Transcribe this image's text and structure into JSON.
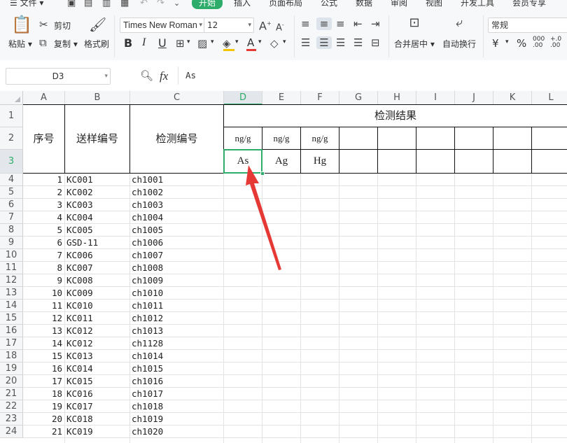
{
  "menu": {
    "items": [
      "文件",
      "开始",
      "插入",
      "页面布局",
      "公式",
      "数据",
      "审阅",
      "视图",
      "开发工具",
      "会员专享"
    ]
  },
  "ribbon": {
    "paste_label": "粘贴",
    "cut_label": "剪切",
    "copy_label": "复制",
    "format_painter_label": "格式刷",
    "font_name": "Times New Roman",
    "font_size": "12",
    "bold": "B",
    "italic": "I",
    "underline": "U",
    "font_color_glyph": "A",
    "merge_center_label": "合并居中",
    "wrap_text_label": "自动换行",
    "number_format": "常规",
    "currency": "¥",
    "percent": "%"
  },
  "formula_bar": {
    "cell_ref": "D3",
    "fx": "fx",
    "value": "As"
  },
  "columns": [
    "A",
    "B",
    "C",
    "D",
    "E",
    "F",
    "G",
    "H",
    "I",
    "J",
    "K",
    "L"
  ],
  "selected_column": "D",
  "selected_row": "3",
  "header_cells": {
    "seq": "序号",
    "sample_no": "送样编号",
    "test_no": "检测编号",
    "result": "检测结果",
    "units": [
      "ng/g",
      "ng/g",
      "ng/g"
    ],
    "elements": [
      "As",
      "Ag",
      "Hg"
    ]
  },
  "rows": [
    {
      "row": "4",
      "seq": "1",
      "sample": "KC001",
      "test": "ch1001"
    },
    {
      "row": "5",
      "seq": "2",
      "sample": "KC002",
      "test": "ch1002"
    },
    {
      "row": "6",
      "seq": "3",
      "sample": "KC003",
      "test": "ch1003"
    },
    {
      "row": "7",
      "seq": "4",
      "sample": "KC004",
      "test": "ch1004"
    },
    {
      "row": "8",
      "seq": "5",
      "sample": "KC005",
      "test": "ch1005"
    },
    {
      "row": "9",
      "seq": "6",
      "sample": "GSD-11",
      "test": "ch1006"
    },
    {
      "row": "10",
      "seq": "7",
      "sample": "KC006",
      "test": "ch1007"
    },
    {
      "row": "11",
      "seq": "8",
      "sample": "KC007",
      "test": "ch1008"
    },
    {
      "row": "12",
      "seq": "9",
      "sample": "KC008",
      "test": "ch1009"
    },
    {
      "row": "13",
      "seq": "10",
      "sample": "KC009",
      "test": "ch1010"
    },
    {
      "row": "14",
      "seq": "11",
      "sample": "KC010",
      "test": "ch1011"
    },
    {
      "row": "15",
      "seq": "12",
      "sample": "KC011",
      "test": "ch1012"
    },
    {
      "row": "16",
      "seq": "13",
      "sample": "KC012",
      "test": "ch1013"
    },
    {
      "row": "17",
      "seq": "14",
      "sample": "KC012",
      "test": "ch1128"
    },
    {
      "row": "18",
      "seq": "15",
      "sample": "KC013",
      "test": "ch1014"
    },
    {
      "row": "19",
      "seq": "16",
      "sample": "KC014",
      "test": "ch1015"
    },
    {
      "row": "20",
      "seq": "17",
      "sample": "KC015",
      "test": "ch1016"
    },
    {
      "row": "21",
      "seq": "18",
      "sample": "KC016",
      "test": "ch1017"
    },
    {
      "row": "22",
      "seq": "19",
      "sample": "KC017",
      "test": "ch1018"
    },
    {
      "row": "23",
      "seq": "20",
      "sample": "KC018",
      "test": "ch1019"
    },
    {
      "row": "24",
      "seq": "21",
      "sample": "KC019",
      "test": "ch1020"
    }
  ],
  "header_row_labels": [
    "1",
    "2",
    "3"
  ],
  "colors": {
    "accent": "#2ead6a",
    "arrow": "#e53935"
  }
}
